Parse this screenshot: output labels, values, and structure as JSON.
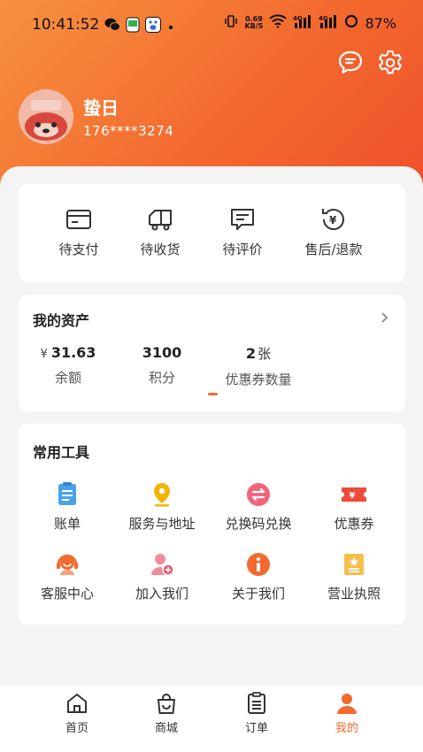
{
  "status_bar": {
    "time": "10:41:52",
    "net_speed_value": "0.69",
    "net_speed_unit": "KB/S",
    "battery": "87%"
  },
  "profile": {
    "username": "蛰日",
    "phone": "176****3274"
  },
  "orders": [
    {
      "label": "待支付",
      "icon": "card-icon"
    },
    {
      "label": "待收货",
      "icon": "truck-icon"
    },
    {
      "label": "待评价",
      "icon": "comment-icon"
    },
    {
      "label": "售后/退款",
      "icon": "refund-icon"
    }
  ],
  "assets": {
    "title": "我的资产",
    "currency": "¥",
    "balance": "31.63",
    "balance_label": "余额",
    "points": "3100",
    "points_label": "积分",
    "coupons": "2",
    "coupons_unit": "张",
    "coupons_label": "优惠券数量"
  },
  "tools": {
    "title": "常用工具",
    "items": [
      {
        "label": "账单",
        "icon": "bill-icon"
      },
      {
        "label": "服务与地址",
        "icon": "location-icon"
      },
      {
        "label": "兑换码兑换",
        "icon": "exchange-icon"
      },
      {
        "label": "优惠券",
        "icon": "coupon-icon"
      },
      {
        "label": "客服中心",
        "icon": "customer-service-icon"
      },
      {
        "label": "加入我们",
        "icon": "add-user-icon"
      },
      {
        "label": "关于我们",
        "icon": "info-icon"
      },
      {
        "label": "营业执照",
        "icon": "license-icon"
      }
    ]
  },
  "nav": [
    {
      "label": "首页",
      "icon": "home-icon"
    },
    {
      "label": "商城",
      "icon": "shop-bag-icon"
    },
    {
      "label": "订单",
      "icon": "order-list-icon"
    },
    {
      "label": "我的",
      "icon": "user-icon",
      "active": true
    }
  ],
  "colors": {
    "accent": "#f26a2f",
    "header_start": "#f7913f",
    "header_end": "#ef4f2b"
  }
}
